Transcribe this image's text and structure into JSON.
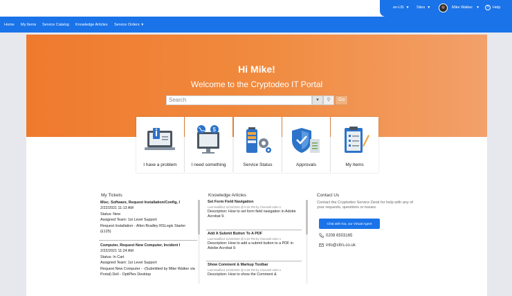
{
  "topbar": {
    "locale": "en-US",
    "sites": "Sites",
    "user": "Mike Walker",
    "help": "Help"
  },
  "nav": {
    "items": [
      "Home",
      "My Items",
      "Service Catalog",
      "Knowledge Articles",
      "Service Orders"
    ]
  },
  "hero": {
    "greeting": "Hi Mike!",
    "welcome": "Welcome to the Cryptodeo IT Portal",
    "search_placeholder": "Search",
    "go": "Go"
  },
  "tiles": [
    {
      "label": "I have a problem",
      "icon": "laptop-info-icon"
    },
    {
      "label": "I need something",
      "icon": "monitor-cart-icon"
    },
    {
      "label": "Service Status",
      "icon": "battery-gear-icon"
    },
    {
      "label": "Approvals",
      "icon": "shield-check-icon"
    },
    {
      "label": "My Items",
      "icon": "clipboard-list-icon"
    }
  ],
  "tickets": {
    "title": "My Tickets",
    "items": [
      {
        "title": "Misc. Software, Request Installation/Config, I",
        "date": "2/22/2021 11:13 AM",
        "status": "Status: New",
        "team": "Assigned Team: 1st Level Support",
        "desc": "Request Installation - Allen Bradley RSLogix Starter (£125)"
      },
      {
        "title": "Computer, Request New Computer, Incident I",
        "date": "2/22/2021 11:24 AM",
        "status": "Status: In Cart",
        "team": "Assigned Team: 1st Level Support",
        "desc": "Request New Computer - -(Submitted by Mike Walker via Portal) Dell - OptiPlex Desktop"
      }
    ]
  },
  "knowledge": {
    "title": "Knowledge Articles",
    "items": [
      {
        "title": "Set Form Field Navigation",
        "meta": "Last Modified 11/23/2020 @ 5:25 PM by Cherwell Admi n",
        "desc": "Description: How to set form field navigation in Adobe Acrobat 9."
      },
      {
        "title": "Add A Submit Button To A PDF",
        "meta": "Last Modified 11/23/2020 @ 5:22 PM by Cherwell Admi n",
        "desc": "Description: How to add a submit button to a PDF in Adobe Acrobat 9."
      },
      {
        "title": "Show Comment & Markup Toolbar",
        "meta": "Last Modified 11/23/2020 @ 5:25 PM by Cherwell Admi n",
        "desc": "Description: How to show the Comment &"
      }
    ]
  },
  "contact": {
    "title": "Contact Us",
    "text": "Contact the Cryptodeo Service Desk for help with any of your requests, questions or issues.",
    "chat_label": "Chat with Kia, our Virtual Agent",
    "phone": "0208 6503165",
    "email": "info@cltrs.co.uk"
  },
  "colors": {
    "brand_blue": "#1a73e8",
    "hero_orange": "#ef7a2e"
  }
}
